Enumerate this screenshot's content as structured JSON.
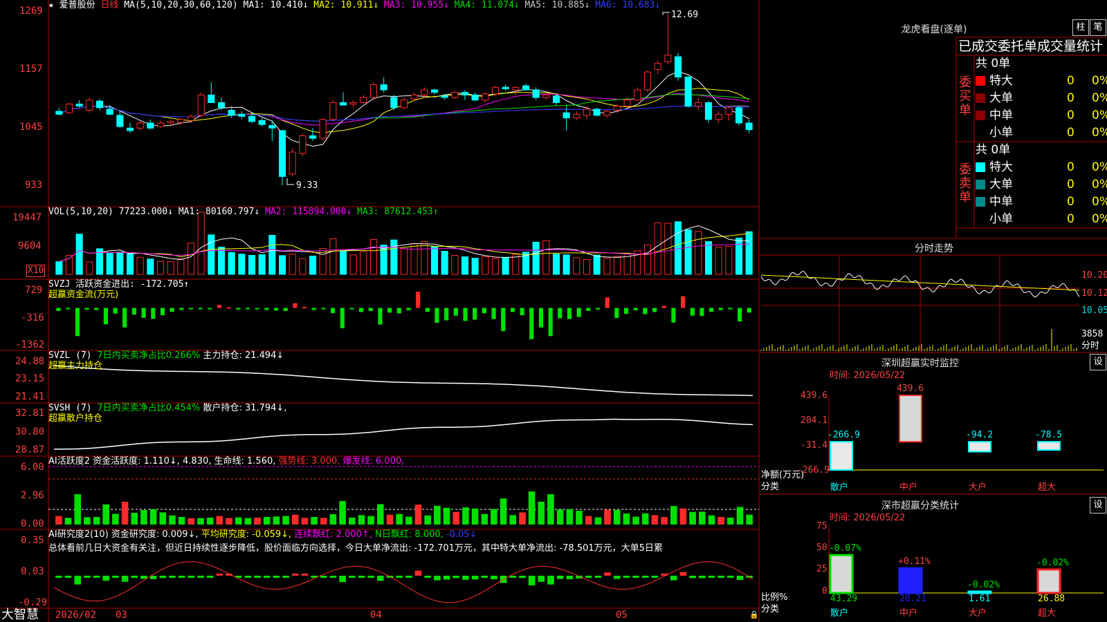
{
  "colors": {
    "up": "#ff2a2a",
    "down": "#00ffff",
    "green": "#00e000",
    "yellow": "#ffff00",
    "magenta": "#ff00ff",
    "white": "#ffffff",
    "blue": "#2020ff",
    "grid": "#b00000",
    "axis_text": "#ff4040"
  },
  "header": {
    "star": "★",
    "stock_name": "爱普股份",
    "period": "日线",
    "ma_spec": "MA(5,10,20,30,60,120)",
    "ma1": "MA1: 10.410↓",
    "ma2": "MA2: 10.911↓",
    "ma3": "MA3: 10.955↓",
    "ma4": "MA4: 11.074↓",
    "ma5": "MA5: 10.885↓",
    "ma6": "MA6: 10.683↓"
  },
  "price_axis": [
    "12.69",
    "11.57",
    "10.45",
    "9.33"
  ],
  "price_axis_shown": [
    "1269",
    "1157",
    "1045",
    "933"
  ],
  "annotations": {
    "high": "12.69",
    "low": "9.33"
  },
  "vol": {
    "label": "VOL(5,10,20)",
    "value": "77223.000↓",
    "ma1": "MA1: 80160.797↓",
    "ma2": "MA2: 115894.000↓",
    "ma3": "MA3: 87612.453↑",
    "axis": [
      "19447",
      "9604"
    ],
    "unit": "X10"
  },
  "svzj": {
    "label": "SVZJ  活跃资金进出: -172.705↑",
    "sub": "超赢资金流(万元)",
    "axis": [
      "729",
      "-316",
      "-1362"
    ]
  },
  "svzl": {
    "label": "SVZL (7) ",
    "green": "7日内买卖净占比0.266%",
    "white": " 主力持仓: 21.494↓",
    "sub": "超赢主力持仓",
    "axis": [
      "24.88",
      "23.15",
      "21.41"
    ]
  },
  "svsh": {
    "label": "SVSH (7) ",
    "green": "7日内买卖净占比0.454%",
    "white": " 散户持仓: 31.794↓,",
    "sub": "超赢散户持仓",
    "axis": [
      "32.81",
      "30.80",
      "28.87"
    ]
  },
  "ai1": {
    "label": "AI活跃度2 资金活跃度: 1.110↓,",
    "v2": " 4.830,",
    "life": " 生命线: 1.560,",
    "strong": " 强势线: 3.000,",
    "burst": " 爆发线: 6.000,",
    "axis": [
      "6.00",
      "2.96",
      "0.00"
    ]
  },
  "ai2": {
    "label": "AI研究度2(10) 资金研究度: 0.009↓,",
    "avg": " 平均研究度: -0.059↓,",
    "cont": " 连续飘红: 2.000↑,",
    "nday": " N日飘红: 8.000,",
    "last": " -0.05↓",
    "axis": [
      "0.35",
      "0.03",
      "-0.29"
    ],
    "summary": "总体看前几日大资金有关注，但近日持续性逐步降低，股价面临方向选择，今日大单净流出: -172.701万元，其中特大单净流出: -78.501万元，大单5日累"
  },
  "footer": {
    "brand": "大智慧",
    "dates": [
      "2026/02",
      "03",
      "04",
      "05"
    ]
  },
  "lhb": {
    "title": "龙虎看盘(逐单)",
    "btn_zhu": "柱",
    "btn_bi": "笔",
    "cols_label": "已成交委托单成交量统计",
    "buy_side": "委买单",
    "sell_side": "委卖单",
    "buy_total": "共 0单",
    "sell_total": "共 0单",
    "buy": [
      {
        "name": "特大",
        "n": "0",
        "p": "0%"
      },
      {
        "name": "大单",
        "n": "0",
        "p": "0%"
      },
      {
        "name": "中单",
        "n": "0",
        "p": "0%"
      },
      {
        "name": "小单",
        "n": "0",
        "p": "0%"
      }
    ],
    "sell": [
      {
        "name": "特大",
        "n": "0",
        "p": "0%"
      },
      {
        "name": "大单",
        "n": "0",
        "p": "0%"
      },
      {
        "name": "中单",
        "n": "0",
        "p": "0%"
      },
      {
        "name": "小单",
        "n": "0",
        "p": "0%"
      }
    ]
  },
  "intraday": {
    "title": "分时走势",
    "axis": [
      "10.20",
      "10.12",
      "10.05"
    ],
    "vol": "3858",
    "unit": "分时"
  },
  "monitor": {
    "title": "深圳超赢实时监控",
    "btn": "设",
    "time": "时间: 2026/05/22",
    "axis": [
      "439.6",
      "204.1",
      "-31.4",
      "-266.9"
    ],
    "ylabel": "净额(万元)",
    "xlabel": "分类",
    "bars": [
      {
        "cat": "散户",
        "val": "-266.9"
      },
      {
        "cat": "中户",
        "val": "439.6"
      },
      {
        "cat": "大户",
        "val": "-94.2"
      },
      {
        "cat": "超大",
        "val": "-78.5"
      }
    ]
  },
  "classify": {
    "title": "深市超赢分类统计",
    "btn": "设",
    "time": "时间: 2026/05/22",
    "axis": [
      "75",
      "50",
      "25",
      "0"
    ],
    "ylabel": "比例%",
    "xlabel": "分类",
    "bars": [
      {
        "cat": "散户",
        "pct": "-0.07%",
        "val": "43.29"
      },
      {
        "cat": "中户",
        "pct": "+0.11%",
        "val": "28.21"
      },
      {
        "cat": "大户",
        "pct": "-0.02%",
        "val": "1.61"
      },
      {
        "cat": "超大",
        "pct": "-0.02%",
        "val": "26.88"
      }
    ]
  },
  "chart_data": {
    "type": "candlestick",
    "ohlc": [
      [
        10.78,
        10.85,
        10.7,
        10.72
      ],
      [
        10.75,
        10.95,
        10.72,
        10.92
      ],
      [
        10.92,
        11.0,
        10.85,
        10.88
      ],
      [
        10.8,
        11.05,
        10.75,
        11.0
      ],
      [
        10.98,
        11.02,
        10.8,
        10.85
      ],
      [
        10.82,
        10.9,
        10.7,
        10.72
      ],
      [
        10.7,
        10.78,
        10.45,
        10.48
      ],
      [
        10.45,
        10.55,
        10.35,
        10.4
      ],
      [
        10.45,
        10.6,
        10.4,
        10.55
      ],
      [
        10.55,
        10.62,
        10.42,
        10.45
      ],
      [
        10.48,
        10.6,
        10.45,
        10.55
      ],
      [
        10.55,
        10.62,
        10.48,
        10.58
      ],
      [
        10.56,
        10.65,
        10.52,
        10.62
      ],
      [
        10.6,
        10.72,
        10.55,
        10.68
      ],
      [
        10.7,
        11.15,
        10.65,
        11.1
      ],
      [
        11.1,
        11.35,
        11.0,
        10.95
      ],
      [
        10.95,
        11.05,
        10.8,
        10.85
      ],
      [
        10.8,
        10.88,
        10.65,
        10.7
      ],
      [
        10.72,
        10.78,
        10.62,
        10.68
      ],
      [
        10.68,
        10.75,
        10.55,
        10.58
      ],
      [
        10.6,
        10.65,
        10.48,
        10.52
      ],
      [
        10.5,
        10.6,
        10.2,
        10.45
      ],
      [
        10.4,
        10.42,
        9.33,
        9.5
      ],
      [
        9.55,
        10.05,
        9.5,
        9.98
      ],
      [
        9.95,
        10.35,
        9.9,
        10.3
      ],
      [
        10.3,
        10.45,
        10.2,
        10.25
      ],
      [
        10.25,
        10.65,
        10.2,
        10.62
      ],
      [
        10.62,
        11.0,
        10.58,
        10.95
      ],
      [
        10.95,
        11.15,
        10.9,
        10.9
      ],
      [
        10.92,
        11.0,
        10.85,
        10.95
      ],
      [
        10.95,
        11.1,
        10.92,
        11.05
      ],
      [
        11.05,
        11.35,
        11.0,
        11.3
      ],
      [
        11.3,
        11.45,
        11.15,
        11.2
      ],
      [
        11.05,
        11.1,
        10.8,
        10.85
      ],
      [
        10.85,
        11.05,
        10.82,
        11.0
      ],
      [
        11.02,
        11.15,
        10.98,
        11.1
      ],
      [
        11.1,
        11.25,
        11.05,
        11.2
      ],
      [
        11.2,
        11.22,
        11.1,
        11.15
      ],
      [
        11.08,
        11.12,
        11.0,
        11.05
      ],
      [
        11.05,
        11.18,
        11.02,
        11.15
      ],
      [
        11.15,
        11.2,
        11.0,
        11.1
      ],
      [
        11.1,
        11.15,
        10.98,
        11.0
      ],
      [
        11.0,
        11.15,
        10.95,
        11.12
      ],
      [
        11.12,
        11.28,
        11.08,
        11.25
      ],
      [
        11.25,
        11.3,
        11.18,
        11.22
      ],
      [
        11.2,
        11.28,
        11.1,
        11.25
      ],
      [
        11.28,
        11.32,
        11.18,
        11.2
      ],
      [
        11.2,
        11.25,
        11.0,
        11.05
      ],
      [
        11.05,
        11.15,
        11.0,
        11.1
      ],
      [
        11.08,
        11.12,
        10.9,
        10.95
      ],
      [
        10.75,
        10.9,
        10.4,
        10.65
      ],
      [
        10.65,
        10.78,
        10.6,
        10.72
      ],
      [
        10.7,
        10.88,
        10.62,
        10.82
      ],
      [
        10.82,
        10.85,
        10.68,
        10.7
      ],
      [
        10.7,
        10.8,
        10.65,
        10.78
      ],
      [
        10.8,
        10.92,
        10.75,
        10.88
      ],
      [
        10.88,
        11.05,
        10.85,
        11.0
      ],
      [
        11.0,
        11.25,
        10.98,
        11.2
      ],
      [
        11.2,
        11.58,
        11.15,
        11.55
      ],
      [
        11.6,
        11.78,
        11.5,
        11.72
      ],
      [
        11.75,
        12.69,
        11.7,
        11.88
      ],
      [
        11.85,
        11.92,
        11.38,
        11.45
      ],
      [
        11.45,
        11.48,
        10.85,
        10.88
      ],
      [
        10.88,
        11.05,
        10.8,
        10.95
      ],
      [
        10.95,
        10.98,
        10.55,
        10.62
      ],
      [
        10.62,
        10.78,
        10.55,
        10.72
      ],
      [
        10.72,
        10.88,
        10.6,
        10.85
      ],
      [
        10.85,
        10.88,
        10.5,
        10.55
      ],
      [
        10.55,
        10.62,
        10.35,
        10.42
      ]
    ],
    "volume": [
      5200,
      7800,
      16500,
      5100,
      10500,
      8600,
      9100,
      8600,
      7000,
      6300,
      5400,
      5200,
      6400,
      12800,
      25500,
      16200,
      11200,
      9000,
      8300,
      7800,
      8100,
      16000,
      7700,
      8400,
      6500,
      7500,
      10600,
      14600,
      9700,
      8000,
      9300,
      14300,
      12000,
      14100,
      10600,
      12500,
      13400,
      11400,
      9500,
      7800,
      7200,
      6600,
      7300,
      6500,
      7000,
      8200,
      9100,
      13200,
      13800,
      8300,
      8000,
      6800,
      6100,
      7900,
      6700,
      7400,
      8400,
      9600,
      12000,
      21100,
      21000,
      21600,
      18300,
      17600,
      13500,
      11200,
      11500,
      14900,
      17500
    ],
    "svzj": [
      -120,
      -40,
      -1080,
      -70,
      -80,
      -630,
      -220,
      -750,
      -260,
      -380,
      -420,
      -280,
      -150,
      -80,
      -20,
      -30,
      -50,
      120,
      30,
      -60,
      -30,
      -50,
      -80,
      -100,
      -120,
      180,
      40,
      -80,
      -40,
      -200,
      -780,
      -50,
      -160,
      -120,
      -640,
      -180,
      -210,
      -90,
      620,
      -150,
      -570,
      -480,
      -300,
      -500,
      -450,
      -210,
      -430,
      -890,
      -160,
      -280,
      -1200,
      -750,
      -1080,
      -400,
      -430,
      -350,
      -120,
      -60,
      400,
      -390,
      -230,
      -90,
      -240,
      -160,
      80,
      -560,
      450,
      -300,
      -310,
      -150,
      -80,
      -50,
      -520,
      -180
    ],
    "y_price": [
      9.33,
      12.69
    ],
    "x_ticks": [
      "2026/02",
      "03",
      "04",
      "05"
    ]
  }
}
